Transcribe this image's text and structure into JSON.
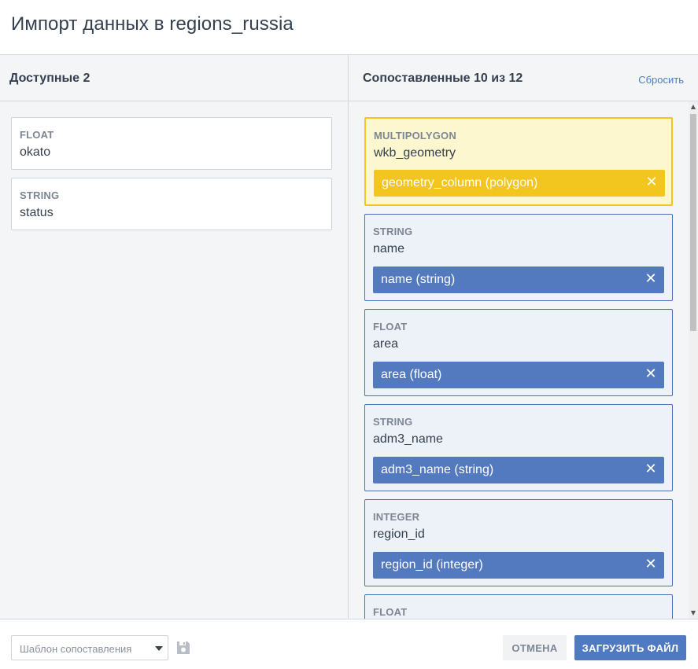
{
  "dialog": {
    "title": "Импорт данных в regions_russia"
  },
  "available": {
    "title": "Доступные 2",
    "items": [
      {
        "type": "FLOAT",
        "name": "okato"
      },
      {
        "type": "STRING",
        "name": "status"
      }
    ]
  },
  "mapped": {
    "title": "Сопоставленные 10 из 12",
    "reset_label": "Сбросить",
    "items": [
      {
        "type": "MULTIPOLYGON",
        "name": "wkb_geometry",
        "chip": "geometry_column (polygon)",
        "close": "✕"
      },
      {
        "type": "STRING",
        "name": "name",
        "chip": "name (string)",
        "close": "✕"
      },
      {
        "type": "FLOAT",
        "name": "area",
        "chip": "area (float)",
        "close": "✕"
      },
      {
        "type": "STRING",
        "name": "adm3_name",
        "chip": "adm3_name (string)",
        "close": "✕"
      },
      {
        "type": "INTEGER",
        "name": "region_id",
        "chip": "region_id (integer)",
        "close": "✕"
      },
      {
        "type": "FLOAT"
      }
    ]
  },
  "scrollbar": {
    "up": "▲",
    "down": "▼"
  },
  "footer": {
    "template_placeholder": "Шаблон сопоставления",
    "cancel_label": "ОТМЕНА",
    "upload_label": "ЗАГРУЗИТЬ ФАЙЛ"
  },
  "colors": {
    "accent": "#4f79c0",
    "chip": "#5379bf",
    "highlight_border": "#f2c51f",
    "highlight_bg": "#fdf7cf"
  },
  "icons": {
    "save": "floppy-disk-icon",
    "dropdown": "caret-down-icon",
    "remove": "close-icon"
  }
}
